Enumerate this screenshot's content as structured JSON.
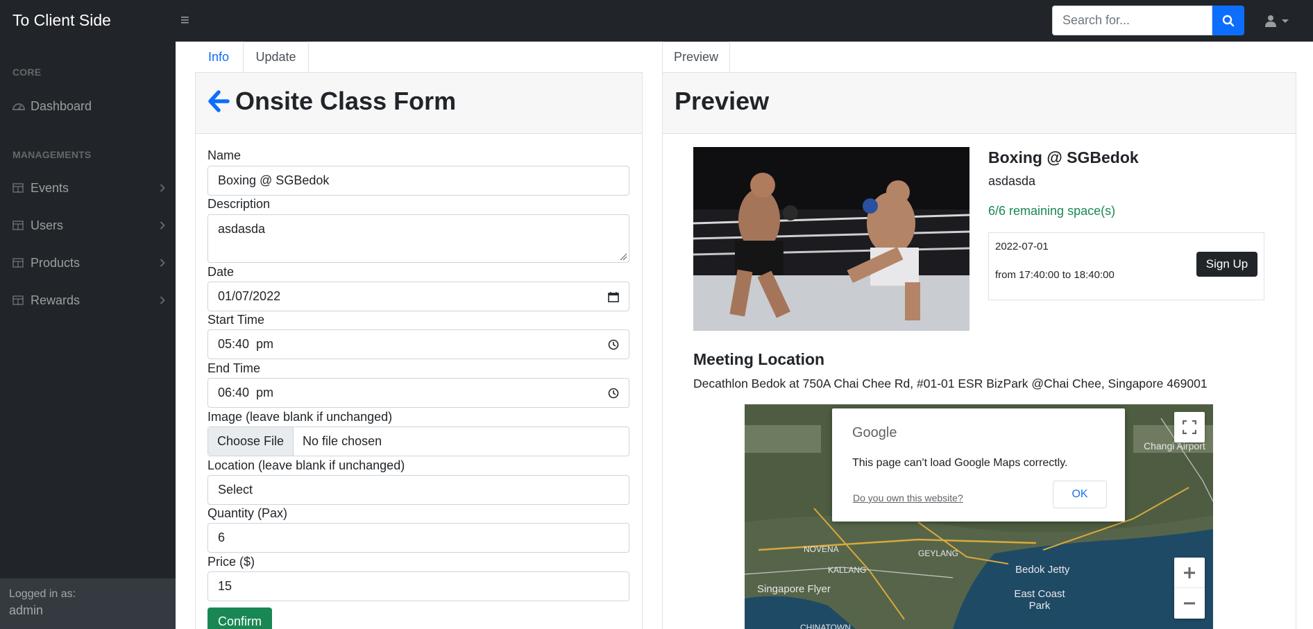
{
  "navbar": {
    "brand": "To Client Side",
    "search_placeholder": "Search for..."
  },
  "sidebar": {
    "core_heading": "CORE",
    "dashboard": "Dashboard",
    "managements_heading": "MANAGEMENTS",
    "items": [
      {
        "label": "Events"
      },
      {
        "label": "Users"
      },
      {
        "label": "Products"
      },
      {
        "label": "Rewards"
      }
    ],
    "footer_label": "Logged in as:",
    "footer_user": "admin"
  },
  "form_tabs": [
    {
      "label": "Info",
      "active": true
    },
    {
      "label": "Update",
      "active": false
    }
  ],
  "preview_tab": {
    "label": "Preview"
  },
  "form": {
    "title": "Onsite Class Form",
    "name_label": "Name",
    "name_value": "Boxing @ SGBedok",
    "description_label": "Description",
    "description_value": "asdasda",
    "date_label": "Date",
    "date_value": "01/07/2022",
    "start_label": "Start Time",
    "start_value": "05:40  pm",
    "end_label": "End Time",
    "end_value": "06:40  pm",
    "image_label": "Image (leave blank if unchanged)",
    "file_button": "Choose File",
    "file_status": "No file chosen",
    "location_label": "Location (leave blank if unchanged)",
    "location_value": "Select",
    "quantity_label": "Quantity (Pax)",
    "quantity_value": "6",
    "price_label": "Price ($)",
    "price_value": "15",
    "confirm_label": "Confirm"
  },
  "preview": {
    "title": "Preview",
    "event_name": "Boxing @ SGBedok",
    "event_desc": "asdasda",
    "remaining": "6/6 remaining space(s)",
    "slot_date": "2022-07-01",
    "slot_time": "from 17:40:00 to 18:40:00",
    "signup_label": "Sign Up",
    "meeting_title": "Meeting Location",
    "meeting_address": "Decathlon Bedok at 750A Chai Chee Rd, #01-01 ESR BizPark @Chai Chee, Singapore 469001"
  },
  "map": {
    "dialog_brand": "Google",
    "dialog_message": "This page can't load Google Maps correctly.",
    "dialog_link": "Do you own this website?",
    "dialog_ok": "OK",
    "labels": [
      "Bedok Jetty",
      "East Coast Park",
      "Singapore Flyer",
      "NOVENA",
      "GEYLANG",
      "KALLANG",
      "CHINATOWN",
      "Changi Airport"
    ]
  },
  "colors": {
    "navbar_bg": "#212529",
    "primary": "#0d6efd",
    "success": "#198754"
  }
}
